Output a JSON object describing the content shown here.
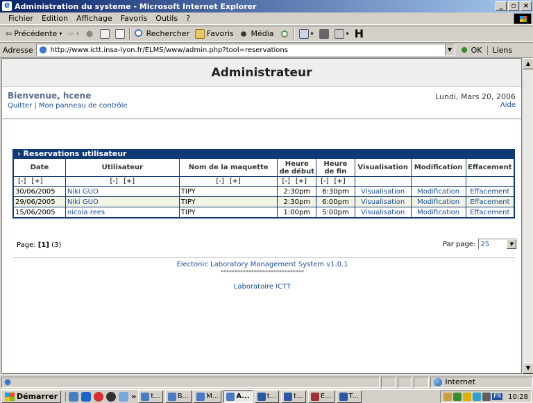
{
  "window": {
    "title": "Administration du systeme - Microsoft Internet Explorer"
  },
  "menu": [
    "Fichier",
    "Edition",
    "Affichage",
    "Favoris",
    "Outils",
    "?"
  ],
  "toolbar": {
    "back": "Précédente",
    "search": "Rechercher",
    "favorites": "Favoris",
    "media": "Média"
  },
  "address": {
    "label": "Adresse",
    "url": "http://www.ictt.insa-lyon.fr/ELMS/www/admin.php?tool=reservations",
    "go": "OK",
    "links": "Liens"
  },
  "page": {
    "title": "Administrateur",
    "welcome": "Bienvenue, hcene",
    "quit": "Quitter",
    "panel": "Mon panneau de contrôle",
    "date": "Lundi, Mars 20, 2006",
    "help": "Aide"
  },
  "reservations": {
    "title": "Reservations utilisateur",
    "columns": [
      "Date",
      "Utilisateur",
      "Nom de la maquette",
      "Heure de début",
      "Heure de fin",
      "Visualisation",
      "Modification",
      "Effacement"
    ],
    "sort": {
      "minus": "[-]",
      "plus": "[+]"
    },
    "rows": [
      {
        "date": "30/06/2005",
        "user": "Niki GUO",
        "model": "TIPY",
        "start": "2:30pm",
        "end": "6:30pm",
        "view": "Visualisation",
        "edit": "Modification",
        "delete": "Effacement"
      },
      {
        "date": "29/06/2005",
        "user": "Niki GUO",
        "model": "TIPY",
        "start": "2:30pm",
        "end": "6:00pm",
        "view": "Visualisation",
        "edit": "Modification",
        "delete": "Effacement"
      },
      {
        "date": "15/06/2005",
        "user": "nicola rees",
        "model": "TIPY",
        "start": "1:00pm",
        "end": "5:00pm",
        "view": "Visualisation",
        "edit": "Modification",
        "delete": "Effacement"
      }
    ]
  },
  "pager": {
    "label": "Page:",
    "current": "[1]",
    "total": "(3)",
    "per_page_label": "Par page:",
    "per_page": "25"
  },
  "footer": {
    "system": "Electonic Laboratory Management System v1.0.1",
    "stars": "******************************",
    "lab": "Laboratoire ICTT"
  },
  "status": {
    "zone": "Internet"
  },
  "taskbar": {
    "start": "Démarrer",
    "tasks": [
      "t...",
      "B...",
      "M...",
      "A...",
      "t...",
      "t...",
      "E...",
      "T..."
    ],
    "lang": "FR",
    "clock": "10:28"
  }
}
